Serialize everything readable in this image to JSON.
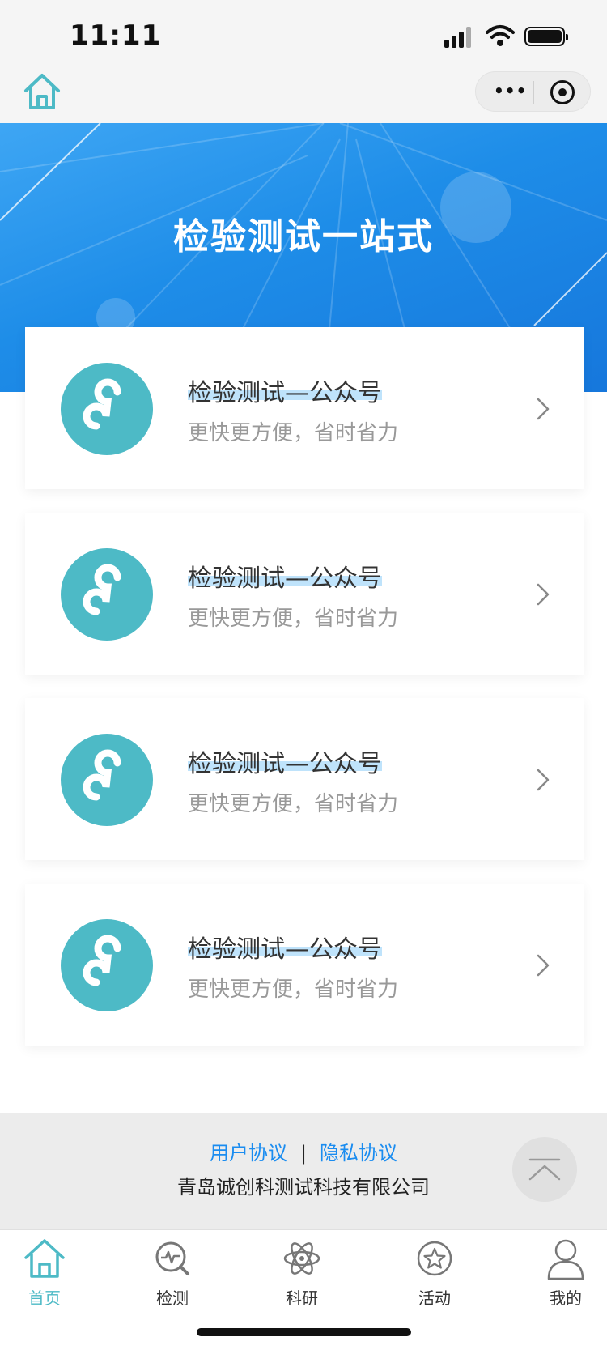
{
  "status_bar": {
    "time": "11:11"
  },
  "nav_bar": {
    "more_icon": "ellipsis-icon",
    "close_icon": "target-icon",
    "home_icon": "home-icon"
  },
  "banner": {
    "title": "检验测试一站式"
  },
  "cards": [
    {
      "title": "检验测试—公众号",
      "subtitle": "更快更方便，省时省力",
      "icon": "mini-program-link-icon"
    },
    {
      "title": "检验测试—公众号",
      "subtitle": "更快更方便，省时省力",
      "icon": "mini-program-link-icon"
    },
    {
      "title": "检验测试—公众号",
      "subtitle": "更快更方便，省时省力",
      "icon": "mini-program-link-icon"
    },
    {
      "title": "检验测试—公众号",
      "subtitle": "更快更方便，省时省力",
      "icon": "mini-program-link-icon"
    }
  ],
  "footer": {
    "user_agreement": "用户协议",
    "separator": "|",
    "privacy_policy": "隐私协议",
    "company": "青岛诚创科测试科技有限公司"
  },
  "tabbar": {
    "items": [
      {
        "label": "首页",
        "icon": "home-icon",
        "active": true
      },
      {
        "label": "检测",
        "icon": "inspection-icon"
      },
      {
        "label": "科研",
        "icon": "atom-icon"
      },
      {
        "label": "活动",
        "icon": "star-icon"
      },
      {
        "label": "我的",
        "icon": "user-icon"
      }
    ]
  },
  "colors": {
    "accent": "#4dbac6",
    "link": "#1a8cf0",
    "banner": "#1e8de8"
  }
}
